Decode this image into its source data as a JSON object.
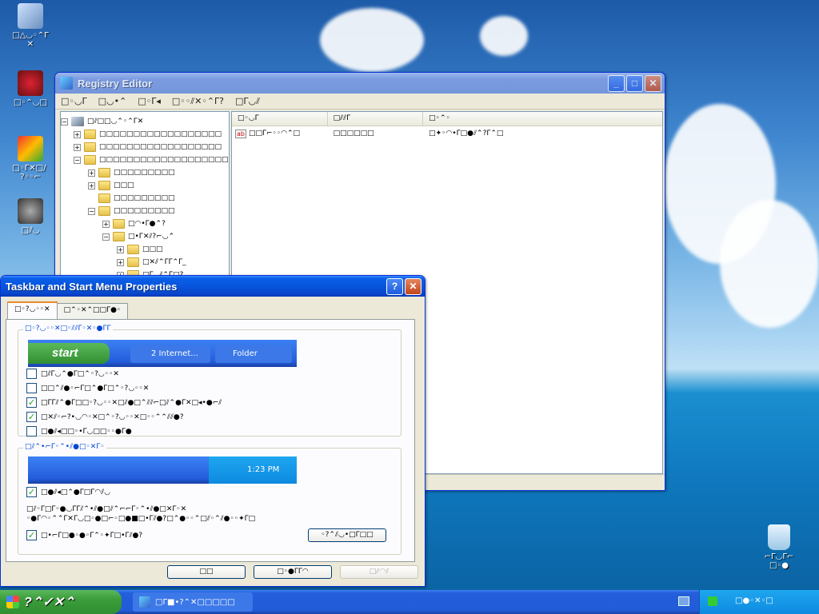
{
  "desktop": {
    "icons": [
      {
        "label": "□△◡◦⌃Γ",
        "sublabel": "✕",
        "kind": "computer"
      },
      {
        "label": "□◦⌃◡□",
        "kind": "network"
      },
      {
        "label": "□◦Γ✕□/ \n?◦◦⌐",
        "kind": "app"
      },
      {
        "label": "□⫽◡",
        "kind": "raccoon"
      },
      {
        "label": "⌐Γ◡Γ⌐\n□◦●",
        "kind": "recycle-bin"
      }
    ]
  },
  "registry": {
    "title": "Registry Editor",
    "menu": [
      "□◦◡Γ",
      "□◡•⌃",
      "□◦Γ◂",
      "□◦◦⫽✕◦⌃Γ?",
      "□Γ◡⫽"
    ],
    "tree": [
      {
        "label": "□⫽□□◡⌃◦⌃Γ✕",
        "indent": 0,
        "pm": "−",
        "folder": false
      },
      {
        "label": "□□□□□□□□□□□□□□□□□□",
        "indent": 1,
        "pm": "+",
        "folder": true
      },
      {
        "label": "□□□□□□□□□□□□□□□□□□",
        "indent": 1,
        "pm": "+",
        "folder": true
      },
      {
        "label": "□□□□□□□□□□□□□□□□□□□□",
        "indent": 1,
        "pm": "−",
        "folder": true
      },
      {
        "label": "□□□□□□□□□",
        "indent": 2,
        "pm": "+",
        "folder": true
      },
      {
        "label": "□□□",
        "indent": 2,
        "pm": "+",
        "folder": true
      },
      {
        "label": "□□□□□□□□□",
        "indent": 2,
        "pm": "",
        "folder": true
      },
      {
        "label": "□□□□□□□□□",
        "indent": 2,
        "pm": "−",
        "folder": true
      },
      {
        "label": "□◠•Γ●⌃?",
        "indent": 3,
        "pm": "+",
        "folder": true
      },
      {
        "label": "□•Γ✕⫽?⌐◡⌃",
        "indent": 3,
        "pm": "−",
        "folder": true
      },
      {
        "label": "□□□",
        "indent": 4,
        "pm": "+",
        "folder": true
      },
      {
        "label": "□✕⫽⌃ΓΓ⌃Γ_",
        "indent": 4,
        "pm": "+",
        "folder": true
      },
      {
        "label": "□Γ◡⫽⌃Γ□?",
        "indent": 4,
        "pm": "+",
        "folder": true
      }
    ],
    "columns": [
      "□◦◡Γ",
      "□⫽⫽Γ",
      "□◦⌃◦"
    ],
    "rows": [
      {
        "name": "□□Γ⌐◦◦◠⌃□",
        "type": "□□□□□□",
        "data": "□✦◦◠•Γ□●⫽⌃?Γ⌃□",
        "badge": "ab"
      }
    ]
  },
  "tbprops": {
    "title": "Taskbar and Start Menu Properties",
    "tabs": [
      "□◦?◡◦◦✕",
      "□⌃◦✕⌃□□Γ●◦"
    ],
    "group1_label": "□◦?◡◦◦✕□◦⫽⫽Γ◦✕◦●ΓΓ",
    "preview": {
      "start": "start",
      "ie": "2 Internet...",
      "folder": "Folder"
    },
    "checks1": [
      {
        "label": "□⫽Γ◡⌃●Γ□⌃◦?◡◦◦✕",
        "checked": false
      },
      {
        "label": "□□⌃⫽●◦⌐Γ□⌃●Γ□⌃◦?◡◦◦✕",
        "checked": false
      },
      {
        "label": "□ΓΓ⫽⌃●Γ□□◦?◡◦◦✕□⫽●□⌃⫽⫽⌐□⫽⌃●Γ✕□◂•●⌐⫽",
        "checked": true
      },
      {
        "label": "□✕⫽◦⌐?•◡◠◦✕□⌃◦?◡◦◦✕□◦◦⌃⌃⫽⫽●?",
        "checked": true
      },
      {
        "label": "□●⫽◂□□◦•Γ◡□□◦◦●Γ●",
        "checked": false
      }
    ],
    "group2_label": "□⫽⌃•⌐Γ◦⌃•⫽●□◦✕Γ◦",
    "clock": "1:23 PM",
    "checks2": [
      {
        "label": "□●⫽◂□⌃●Γ□Γ◠⫽◡",
        "checked": true
      }
    ],
    "desc1": "□⫽◦Γ□Γ◦●◡ΓΓ⫽⌃•⫽●□⫽⌃⌐⌐Γ◦⌃•⫽●□✕Γ◦✕",
    "desc2": "◦●Γ◠◦⌃⌃Γ✕Γ◡□◦●□⌐◦□●■□•Γ⫽●?□⌃●◦◦⌃□⫽◦⌃⫽●◦◦✦Γ□",
    "last_check": {
      "label": "□•⌐Γ□●◦●◦Γ⌃◦✦Γ□•Γ⫽●?",
      "checked": true
    },
    "customize": "◦?⌃⫽◡•□Γ□□",
    "ok": "□□",
    "cancel": "□◦●ΓΓ◠",
    "apply": "□⫽◠⫽"
  },
  "taskbar": {
    "start": "?⌃✓✕⌃",
    "task": "□Γ■•?⌃✕□□□□□",
    "tray_time": "□●◦✕◦□"
  }
}
